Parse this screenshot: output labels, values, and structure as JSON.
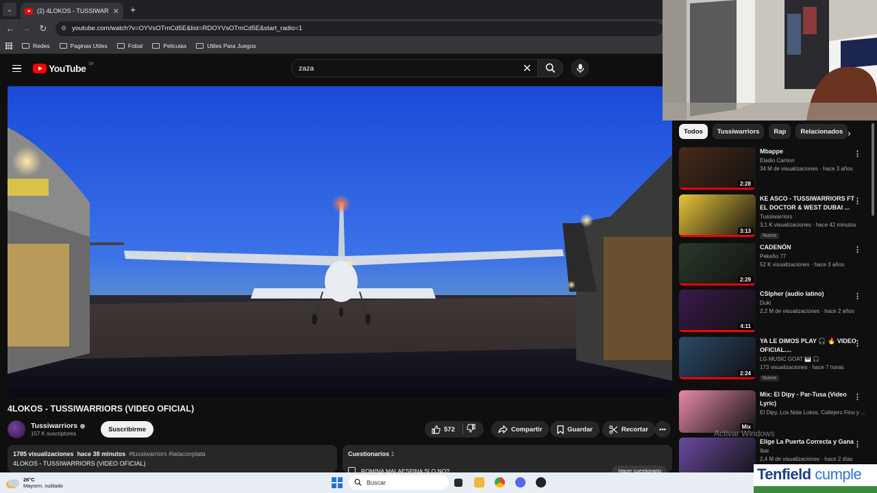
{
  "browser": {
    "tab_title": "(2) 4LOKOS - TUSSIWARRIORS",
    "url": "youtube.com/watch?v=OYVsOTmCd5E&list=RDOYVsOTmCd5E&start_radio=1",
    "bookmarks": [
      "Redes",
      "Paginas Utiles",
      "Fobal",
      "Peliculas",
      "Utiles Para Juegos"
    ]
  },
  "youtube": {
    "logo_text": "YouTube",
    "region": "UY",
    "search_value": "zaza"
  },
  "video": {
    "title": "4LOKOS - TUSSIWARRIORS (VIDEO OFICIAL)",
    "channel": "Tussiwarriors",
    "subscribers": "157 K suscriptores",
    "subscribe_label": "Suscribirme",
    "likes": "572",
    "share_label": "Compartir",
    "save_label": "Guardar",
    "clip_label": "Recortar",
    "views": "1785 visualizaciones",
    "time_ago": "hace 38 minutos",
    "tags": "#tussiwarriors #lataconplata",
    "desc_title": "4LOKOS - TUSSIWARRIORS (VIDEO OFICIAL)"
  },
  "quiz": {
    "title": "Cuestionarios",
    "count": "1",
    "question": "ROMINA MALAESPINA SLO NO?",
    "button": "Hacer cuestionario"
  },
  "chips": [
    "Todos",
    "Tussiwarriors",
    "Rap",
    "Relacionados"
  ],
  "recommendations": [
    {
      "title": "Mbappe",
      "channel": "Eladio Carrion",
      "meta": "34 M de visualizaciones · hace 3 años",
      "duration": "2:28",
      "badge": "",
      "color": "#4a2a1a"
    },
    {
      "title": "KE ASCO - TUSSIWARRIORS FT EL DOCTOR & WEST DUBAI ...",
      "channel": "Tussiwarriors",
      "meta": "3,1 K visualizaciones · hace 42 minutos",
      "duration": "3:13",
      "badge": "Nuevo",
      "color": "#e9c43a"
    },
    {
      "title": "CADENÓN",
      "channel": "Pekeño 77",
      "meta": "52 K visualizaciones · hace 3 años",
      "duration": "2:29",
      "badge": "",
      "color": "#2a3a2a"
    },
    {
      "title": "CSIpher (audio latino)",
      "channel": "Duki",
      "meta": "2,2 M de visualizaciones · hace 2 años",
      "duration": "4:11",
      "badge": "",
      "color": "#3a1a4a"
    },
    {
      "title": "YA LE DIMOS PLAY 🎧 🔥 VIDEO OFICIAL....",
      "channel": "LG MUSIC GOAT 🎹 🎧",
      "meta": "173 visualizaciones · hace 7 horas",
      "duration": "2:24",
      "badge": "Nuevo",
      "color": "#2a4a6a"
    },
    {
      "title": "Mix: El Dipy - Par-Tusa (Video Lyric)",
      "channel": "El Dipy, Los Nota Lokos, Callejero Fino y ...",
      "meta": "",
      "duration": "Mix",
      "badge": "",
      "color": "#e88aa8"
    },
    {
      "title": "Elige La Puerta Correcta y Gana",
      "channel": "Ibai",
      "meta": "2,4 M de visualizaciones · hace 2 días",
      "duration": "",
      "badge": "",
      "color": "#6a4aa0"
    }
  ],
  "overlay": {
    "activate_windows": "Activar Windows",
    "sponsor_a": "Tenfield",
    "sponsor_b": "cumple"
  },
  "taskbar": {
    "temp": "26°C",
    "weather": "Mayorm. nublado",
    "search": "Buscar"
  }
}
